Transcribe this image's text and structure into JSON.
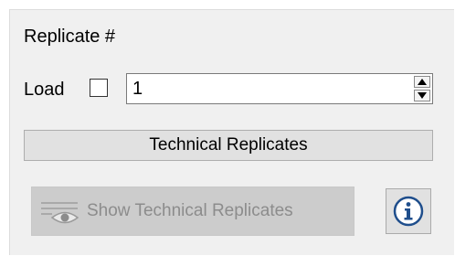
{
  "replicate_group": {
    "title": "Replicate #",
    "load_label": "Load",
    "load_checked": false,
    "replicate_value": "1"
  },
  "technical_replicates_button": {
    "label": "Technical Replicates"
  },
  "show_technical_replicates_button": {
    "label": "Show Technical Replicates",
    "enabled": false,
    "icon": "eye-list-icon"
  },
  "info_button": {
    "icon": "info-icon",
    "accent_color": "#1f4e8c"
  }
}
